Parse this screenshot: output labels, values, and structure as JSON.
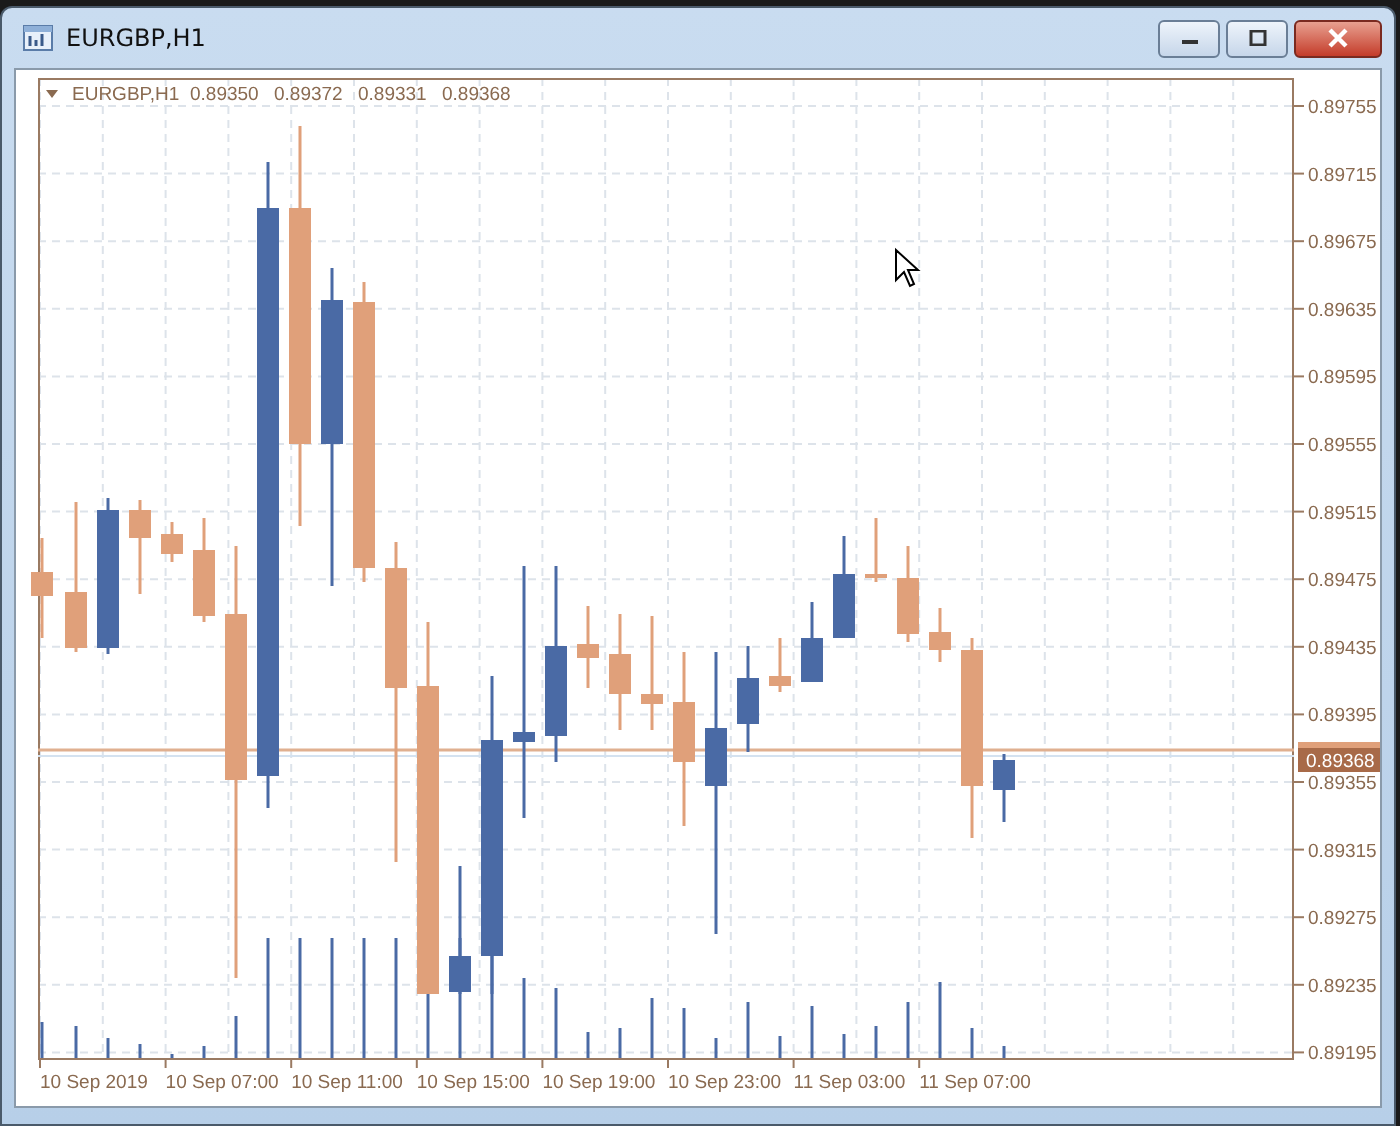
{
  "window": {
    "title": "EURGBP,H1"
  },
  "chart": {
    "symbol": "EURGBP,H1",
    "quote": [
      "0.89350",
      "0.89372",
      "0.89331",
      "0.89368"
    ],
    "price_axis": [
      "0.89755",
      "0.89715",
      "0.89675",
      "0.89635",
      "0.89595",
      "0.89555",
      "0.89515",
      "0.89475",
      "0.89435",
      "0.89395",
      "0.89355",
      "0.89315",
      "0.89275",
      "0.89235",
      "0.89195"
    ],
    "current_price": "0.89368",
    "time_axis": [
      "10 Sep 2019",
      "10 Sep 07:00",
      "10 Sep 11:00",
      "10 Sep 15:00",
      "10 Sep 19:00",
      "10 Sep 23:00",
      "11 Sep 03:00",
      "11 Sep 07:00"
    ]
  }
}
